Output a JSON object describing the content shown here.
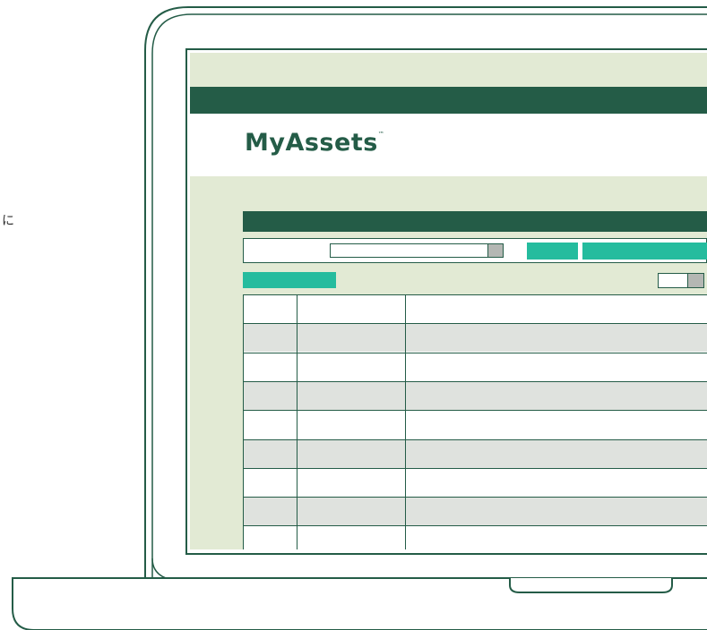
{
  "side_text": "に",
  "app": {
    "logo_text": "MyAssets",
    "trademark": "™"
  },
  "table": {
    "row_count": 9,
    "shaded_rows": [
      1,
      3,
      5,
      7
    ]
  },
  "colors": {
    "dark_green": "#245c47",
    "teal": "#25bc9e",
    "light_green_bg": "#e2ead4",
    "row_shade": "#dfe2de",
    "control_gray": "#b4b7b3"
  }
}
